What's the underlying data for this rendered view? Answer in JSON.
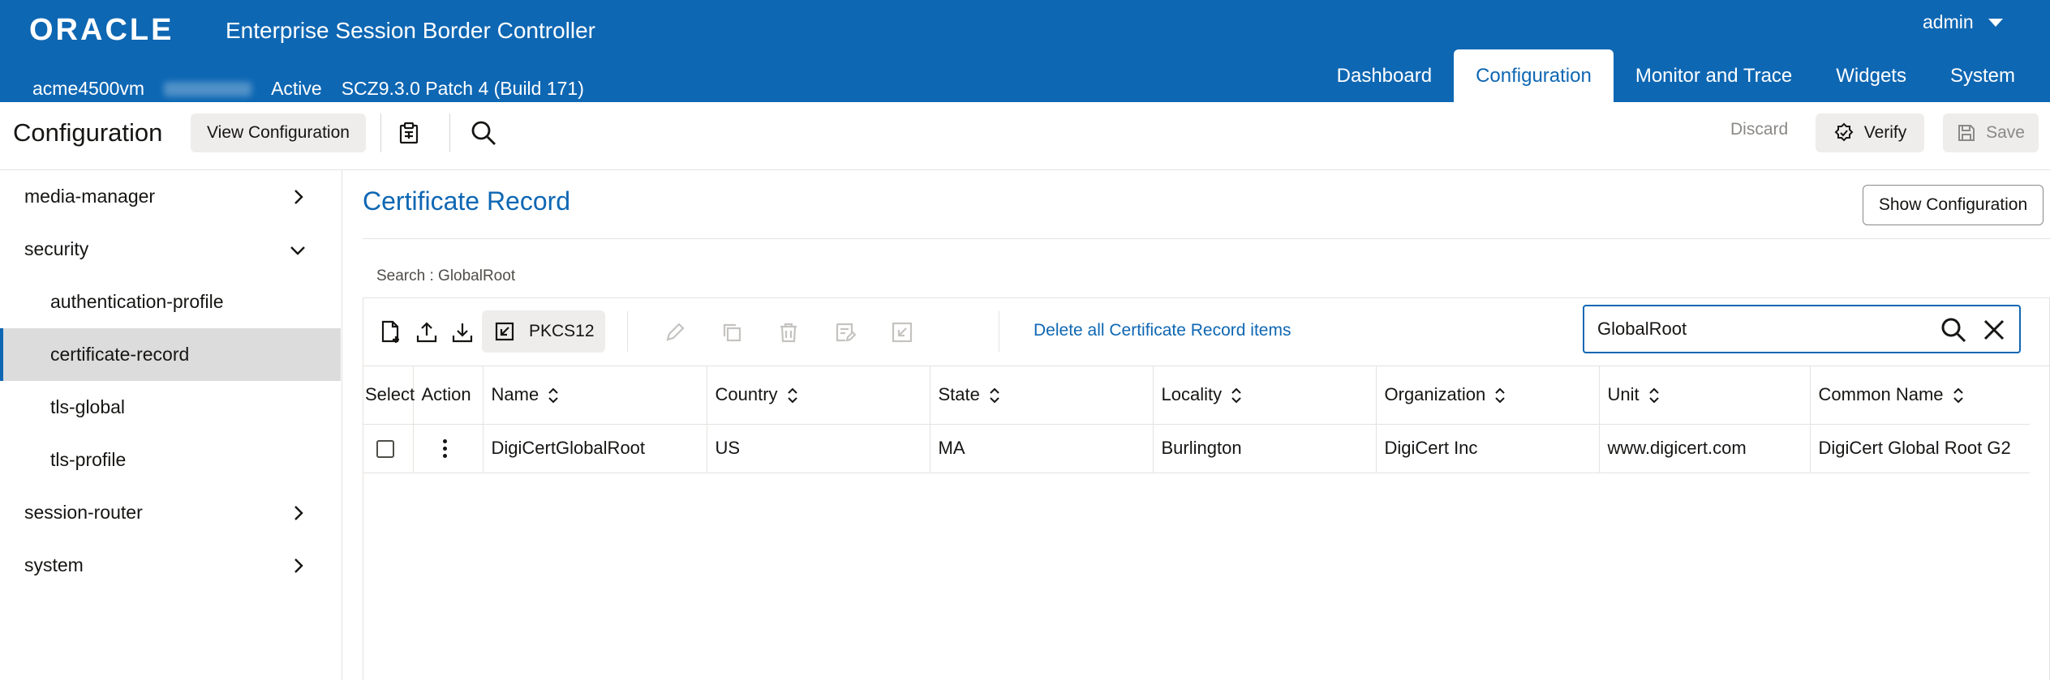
{
  "header": {
    "brand": "ORACLE",
    "product": "Enterprise Session Border Controller",
    "user": "admin",
    "host": "acme4500vm",
    "status": "Active",
    "version": "SCZ9.3.0 Patch 4 (Build 171)",
    "nav": [
      {
        "label": "Dashboard"
      },
      {
        "label": "Configuration",
        "active": true
      },
      {
        "label": "Monitor and Trace"
      },
      {
        "label": "Widgets"
      },
      {
        "label": "System"
      }
    ]
  },
  "toolbar": {
    "title": "Configuration",
    "view_configuration": "View Configuration",
    "discard": "Discard",
    "verify": "Verify",
    "save": "Save"
  },
  "sidebar": {
    "items": [
      {
        "label": "media-manager",
        "level": 1,
        "chevron": "right"
      },
      {
        "label": "security",
        "level": 1,
        "chevron": "down"
      },
      {
        "label": "authentication-profile",
        "level": 2
      },
      {
        "label": "certificate-record",
        "level": 2,
        "selected": true
      },
      {
        "label": "tls-global",
        "level": 2
      },
      {
        "label": "tls-profile",
        "level": 2
      },
      {
        "label": "session-router",
        "level": 1,
        "chevron": "right"
      },
      {
        "label": "system",
        "level": 1,
        "chevron": "right"
      }
    ]
  },
  "main": {
    "title": "Certificate Record",
    "show_configuration": "Show Configuration",
    "search_label": "Search : GlobalRoot",
    "pkcs_label": "PKCS12",
    "delete_all": "Delete all Certificate Record items",
    "search_value": "GlobalRoot",
    "columns": [
      "Select",
      "Action",
      "Name",
      "Country",
      "State",
      "Locality",
      "Organization",
      "Unit",
      "Common Name"
    ],
    "rows": [
      {
        "name": "DigiCertGlobalRoot",
        "country": "US",
        "state": "MA",
        "locality": "Burlington",
        "organization": "DigiCert Inc",
        "unit": "www.digicert.com",
        "common_name": "DigiCert Global Root G2"
      }
    ]
  },
  "colors": {
    "brand_blue": "#0e67b3",
    "selected_bg": "#dcdcdc",
    "button_gray": "#eeedeb"
  }
}
